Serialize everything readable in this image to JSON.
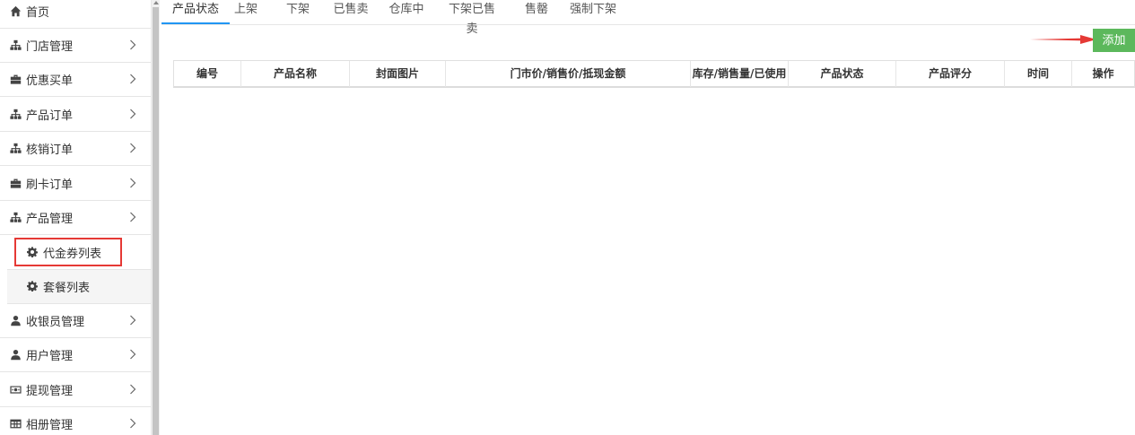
{
  "sidebar": {
    "items": [
      {
        "label": "首页",
        "icon": "home-icon",
        "has_chevron": false
      },
      {
        "label": "门店管理",
        "icon": "sitemap-icon",
        "has_chevron": true
      },
      {
        "label": "优惠买单",
        "icon": "briefcase-icon",
        "has_chevron": true
      },
      {
        "label": "产品订单",
        "icon": "sitemap-icon",
        "has_chevron": true
      },
      {
        "label": "核销订单",
        "icon": "sitemap-icon",
        "has_chevron": true
      },
      {
        "label": "刷卡订单",
        "icon": "briefcase-icon",
        "has_chevron": true
      },
      {
        "label": "产品管理",
        "icon": "sitemap-icon",
        "has_chevron": true,
        "expanded": true
      },
      {
        "label": "收银员管理",
        "icon": "user-icon",
        "has_chevron": true
      },
      {
        "label": "用户管理",
        "icon": "user-icon",
        "has_chevron": true
      },
      {
        "label": "提现管理",
        "icon": "money-icon",
        "has_chevron": true
      },
      {
        "label": "相册管理",
        "icon": "table-icon",
        "has_chevron": true
      }
    ],
    "subitems": [
      {
        "label": "代金券列表",
        "icon": "gear-icon",
        "active": true
      },
      {
        "label": "套餐列表",
        "icon": "gear-icon",
        "active": false
      }
    ]
  },
  "tabs": [
    {
      "label": "产品状态",
      "active": true
    },
    {
      "label": "上架",
      "active": false
    },
    {
      "label": "下架",
      "active": false
    },
    {
      "label": "已售卖",
      "active": false
    },
    {
      "label": "仓库中",
      "active": false
    },
    {
      "label": "下架已售卖",
      "active": false
    },
    {
      "label": "售罄",
      "active": false
    },
    {
      "label": "强制下架",
      "active": false
    }
  ],
  "toolbar": {
    "add_label": "添加"
  },
  "table": {
    "headers": [
      "编号",
      "产品名称",
      "封面图片",
      "门市价/销售价/抵现金额",
      "库存/销售量/已使用",
      "产品状态",
      "产品评分",
      "时间",
      "操作"
    ]
  },
  "colors": {
    "accent_tab": "#2196f3",
    "add_button": "#5cb85c",
    "highlight_red": "#e53935"
  }
}
